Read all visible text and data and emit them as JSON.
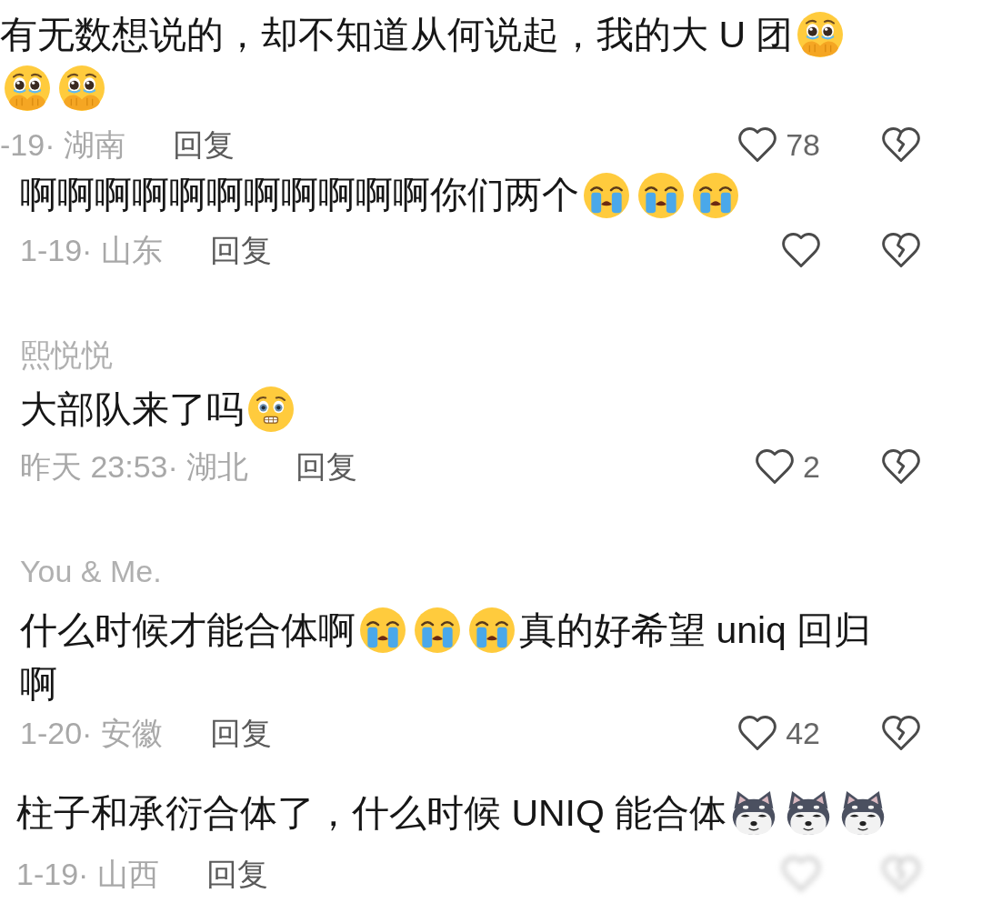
{
  "comments": [
    {
      "body": [
        {
          "kind": "text",
          "text": "有无数想说的，却不知道从何说起，我的大 U 团"
        },
        {
          "kind": "pleading"
        },
        {
          "kind": "pleading"
        },
        {
          "kind": "pleading"
        }
      ],
      "meta": "-19· 湖南",
      "reply": "回复",
      "likes": "78",
      "obscured": false
    },
    {
      "body": [
        {
          "kind": "text",
          "text": "啊啊啊啊啊啊啊啊啊啊啊你们两个"
        },
        {
          "kind": "crying"
        },
        {
          "kind": "crying"
        },
        {
          "kind": "crying"
        }
      ],
      "meta": "1-19· 山东",
      "reply": "回复",
      "obscured": false
    },
    {
      "user": "熙悦悦",
      "body": [
        {
          "kind": "text",
          "text": "大部队来了吗"
        },
        {
          "kind": "worried"
        }
      ],
      "meta": "昨天 23:53· 湖北",
      "reply": "回复",
      "likes": "2",
      "obscured": false
    },
    {
      "user": "You & Me.",
      "body": [
        {
          "kind": "text",
          "text": "什么时候才能合体啊"
        },
        {
          "kind": "crying"
        },
        {
          "kind": "crying"
        },
        {
          "kind": "crying"
        },
        {
          "kind": "text",
          "text": "真的好希望 uniq 回归"
        },
        {
          "kind": "text",
          "text": "啊"
        }
      ],
      "meta": "1-20· 安徽",
      "reply": "回复",
      "likes": "42",
      "obscured": false
    },
    {
      "body": [
        {
          "kind": "text",
          "text": "柱子和承衍合体了，什么时候 UNIQ 能合体"
        },
        {
          "kind": "dog"
        },
        {
          "kind": "dog"
        },
        {
          "kind": "dog"
        }
      ],
      "meta": "1-19· 山西",
      "reply": "回复",
      "obscured": true
    }
  ]
}
